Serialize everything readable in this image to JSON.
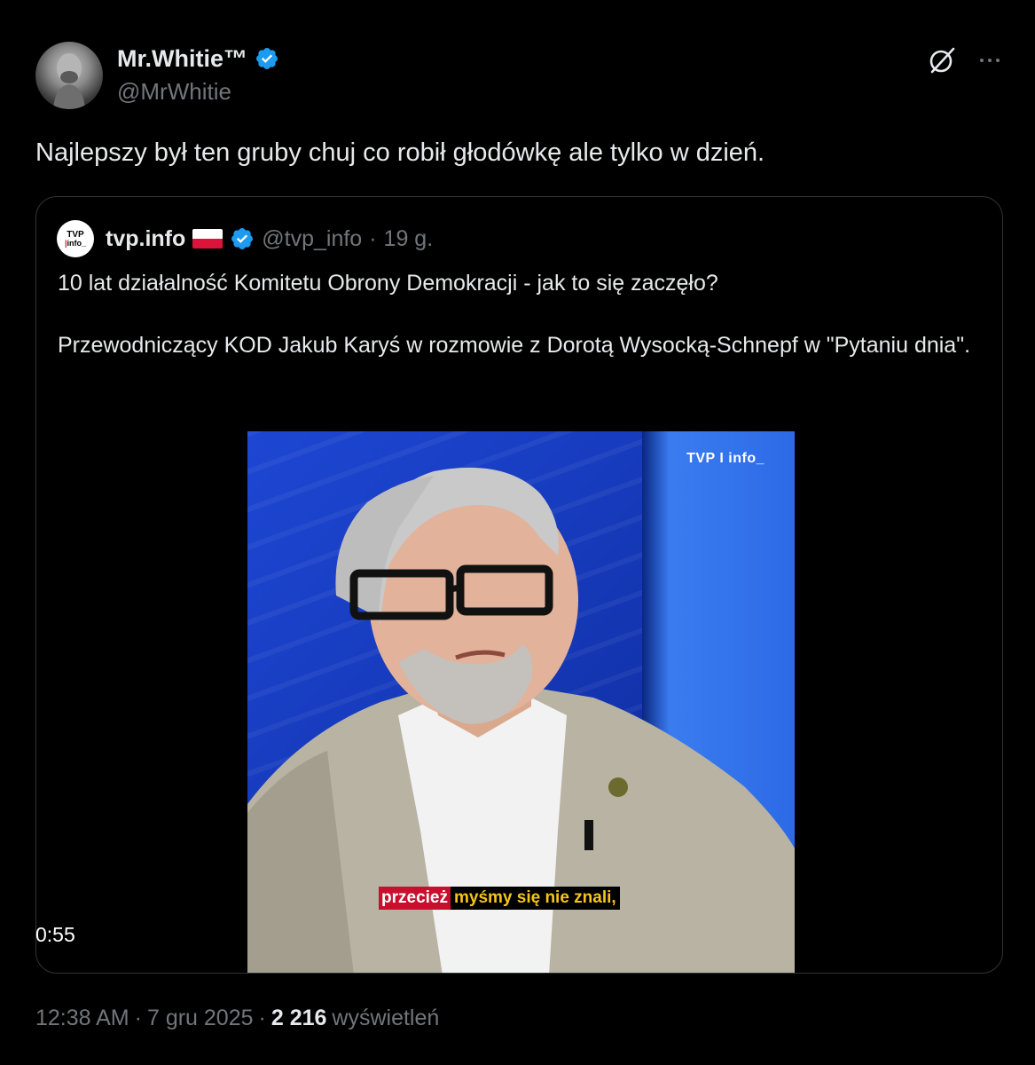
{
  "author": {
    "name": "Mr.Whitie™",
    "handle": "@MrWhitie",
    "verified": true
  },
  "tweet": {
    "text": "Najlepszy był ten gruby chuj co robił głodówkę ale tylko w dzień."
  },
  "icons": {
    "grok": "grok-icon",
    "more": "more-dots-icon",
    "verified": "verified-badge-icon",
    "flag": "poland-flag-icon"
  },
  "colors": {
    "background": "#000000",
    "text": "#e7e9ea",
    "muted": "#71767b",
    "verified": "#1d9bf0",
    "border": "#2f3336"
  },
  "quote": {
    "avatar_line1": "TVP",
    "avatar_line2": "info_",
    "name": "tvp.info",
    "handle": "@tvp_info",
    "separator": "·",
    "time": "19 g.",
    "text_p1": "10 lat działalność Komitetu Obrony Demokracji - jak to się zaczęło?",
    "text_p2": "Przewodniczący KOD Jakub Karyś w rozmowie z Dorotą Wysocką-Schnepf w \"Pytaniu dnia\".",
    "video": {
      "logo": "TVP I info_",
      "subtitle_part1": "przecież",
      "subtitle_part2": "myśmy się nie znali,",
      "duration": "0:55"
    }
  },
  "meta": {
    "time": "12:38 AM",
    "sep1": "·",
    "date": "7 gru 2025",
    "sep2": "·",
    "views_count": "2 216",
    "views_label": "wyświetleń"
  }
}
